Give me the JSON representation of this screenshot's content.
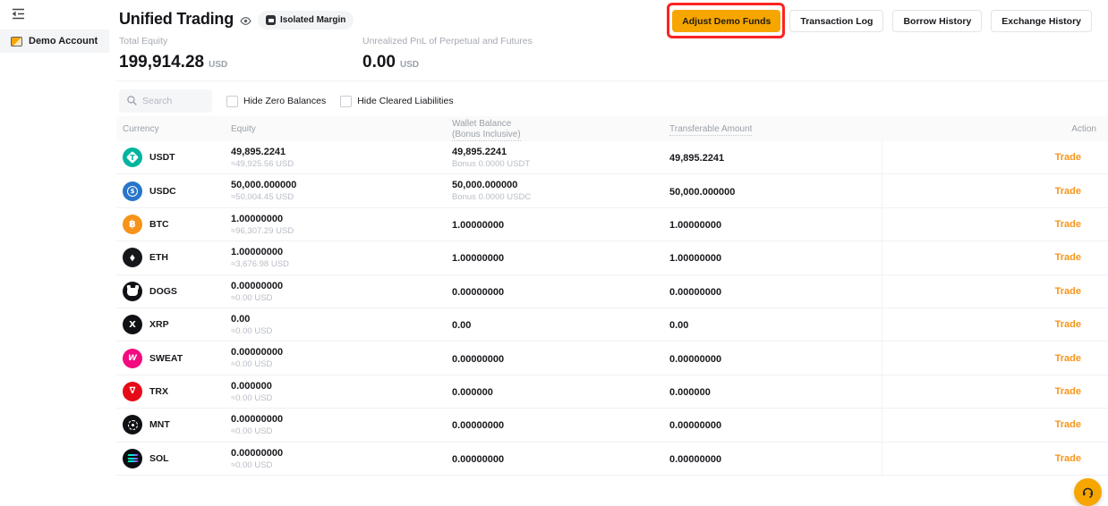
{
  "sidebar": {
    "items": [
      {
        "label": "Demo Account",
        "selected": true
      }
    ]
  },
  "header": {
    "title": "Unified Trading",
    "margin_badge": "Isolated Margin",
    "buttons": {
      "adjust": "Adjust Demo Funds",
      "others": [
        "Transaction Log",
        "Borrow History",
        "Exchange History"
      ]
    }
  },
  "stats": [
    {
      "label": "Total Equity",
      "value": "199,914.28",
      "unit": "USD"
    },
    {
      "label": "Unrealized PnL of Perpetual and Futures",
      "value": "0.00",
      "unit": "USD"
    }
  ],
  "filters": {
    "search_placeholder": "Search",
    "checkboxes": [
      "Hide Zero Balances",
      "Hide Cleared Liabilities"
    ]
  },
  "table": {
    "columns": {
      "currency": "Currency",
      "equity": "Equity",
      "wallet_line1": "Wallet Balance",
      "wallet_line2": "(Bonus Inclusive)",
      "transferable": "Transferable Amount",
      "action": "Action"
    },
    "trade_label": "Trade",
    "rows": [
      {
        "symbol": "USDT",
        "icon": "usdt",
        "equity": "49,895.2241",
        "equity_usd": "≈49,925.56 USD",
        "wallet": "49,895.2241",
        "bonus": "Bonus 0.0000 USDT",
        "transferable": "49,895.2241"
      },
      {
        "symbol": "USDC",
        "icon": "usdc",
        "equity": "50,000.000000",
        "equity_usd": "≈50,004.45 USD",
        "wallet": "50,000.000000",
        "bonus": "Bonus 0.0000 USDC",
        "transferable": "50,000.000000"
      },
      {
        "symbol": "BTC",
        "icon": "btc",
        "equity": "1.00000000",
        "equity_usd": "≈96,307.29 USD",
        "wallet": "1.00000000",
        "bonus": "",
        "transferable": "1.00000000"
      },
      {
        "symbol": "ETH",
        "icon": "eth",
        "equity": "1.00000000",
        "equity_usd": "≈3,676.98 USD",
        "wallet": "1.00000000",
        "bonus": "",
        "transferable": "1.00000000"
      },
      {
        "symbol": "DOGS",
        "icon": "dogs",
        "equity": "0.00000000",
        "equity_usd": "≈0.00 USD",
        "wallet": "0.00000000",
        "bonus": "",
        "transferable": "0.00000000"
      },
      {
        "symbol": "XRP",
        "icon": "xrp",
        "equity": "0.00",
        "equity_usd": "≈0.00 USD",
        "wallet": "0.00",
        "bonus": "",
        "transferable": "0.00"
      },
      {
        "symbol": "SWEAT",
        "icon": "sweat",
        "equity": "0.00000000",
        "equity_usd": "≈0.00 USD",
        "wallet": "0.00000000",
        "bonus": "",
        "transferable": "0.00000000"
      },
      {
        "symbol": "TRX",
        "icon": "trx",
        "equity": "0.000000",
        "equity_usd": "≈0.00 USD",
        "wallet": "0.000000",
        "bonus": "",
        "transferable": "0.000000"
      },
      {
        "symbol": "MNT",
        "icon": "mnt",
        "equity": "0.00000000",
        "equity_usd": "≈0.00 USD",
        "wallet": "0.00000000",
        "bonus": "",
        "transferable": "0.00000000"
      },
      {
        "symbol": "SOL",
        "icon": "sol",
        "equity": "0.00000000",
        "equity_usd": "≈0.00 USD",
        "wallet": "0.00000000",
        "bonus": "",
        "transferable": "0.00000000"
      }
    ]
  },
  "colors": {
    "accent": "#f7a600",
    "trade_link": "#f7941a",
    "annotation_red": "#fb2323"
  },
  "icon_colors": {
    "usdt": "#00b49e",
    "usdc": "#2775ca",
    "btc": "#f7931a",
    "eth": "#16171b",
    "dogs": "#101114",
    "xrp": "#101114",
    "sweat": "#f20a7e",
    "trx": "#e60a17",
    "mnt": "#101114",
    "sol": "#0c0d12"
  }
}
